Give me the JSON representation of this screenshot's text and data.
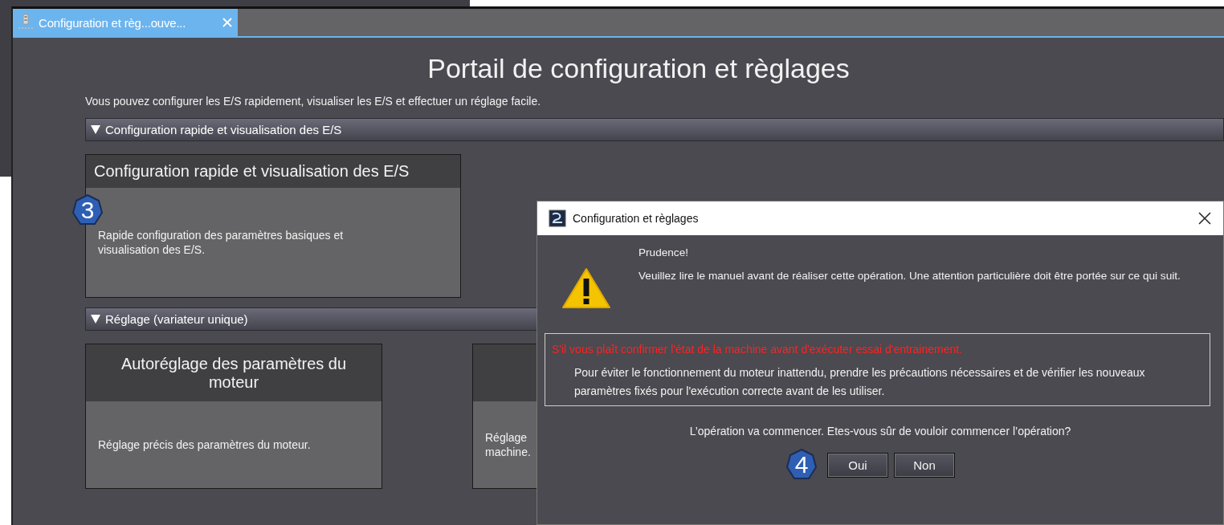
{
  "tab": {
    "label": "Configuration et règ...ouve...",
    "selected": true
  },
  "portal": {
    "title": "Portail de configuration et règlages",
    "description": "Vous pouvez configurer les E/S rapidement, visualiser les E/S et effectuer un réglage facile.",
    "sections": [
      {
        "label": "Configuration rapide et visualisation des E/S",
        "expanded": true,
        "cards": [
          {
            "title": "Configuration rapide et visualisation des E/S",
            "text": "Rapide configuration des paramètres basiques et visualisation des E/S.",
            "kind": "compact",
            "badge": "3"
          }
        ]
      },
      {
        "label": "Réglage (variateur unique)",
        "expanded": true,
        "cards": [
          {
            "title": "Autoréglage des paramètres du moteur",
            "text": "Réglage précis des paramètres du moteur.",
            "kind": "tall"
          },
          {
            "text": "Réglage machine.",
            "kind": "tall"
          }
        ]
      }
    ]
  },
  "dialog": {
    "title": "Configuration et règlages",
    "heading": "Prudence!",
    "message": "Veuillez lire le manuel avant de réaliser cette opération. Une attention particulière doit être portée sur ce qui suit.",
    "warning": "S'il vous plaît confirmer l'état de la machine avant d'exécuter essai d'entrainement.",
    "detail": "Pour éviter le fonctionnement du moteur inattendu, prendre les précautions nécessaires et de vérifier les nouveaux paramètres fixés pour l'exécution correcte avant de les utiliser.",
    "question": "L’opération va commencer. Etes-vous sûr de vouloir commencer l’opération?",
    "badge": "4",
    "buttons": [
      "Oui",
      "Non"
    ]
  }
}
